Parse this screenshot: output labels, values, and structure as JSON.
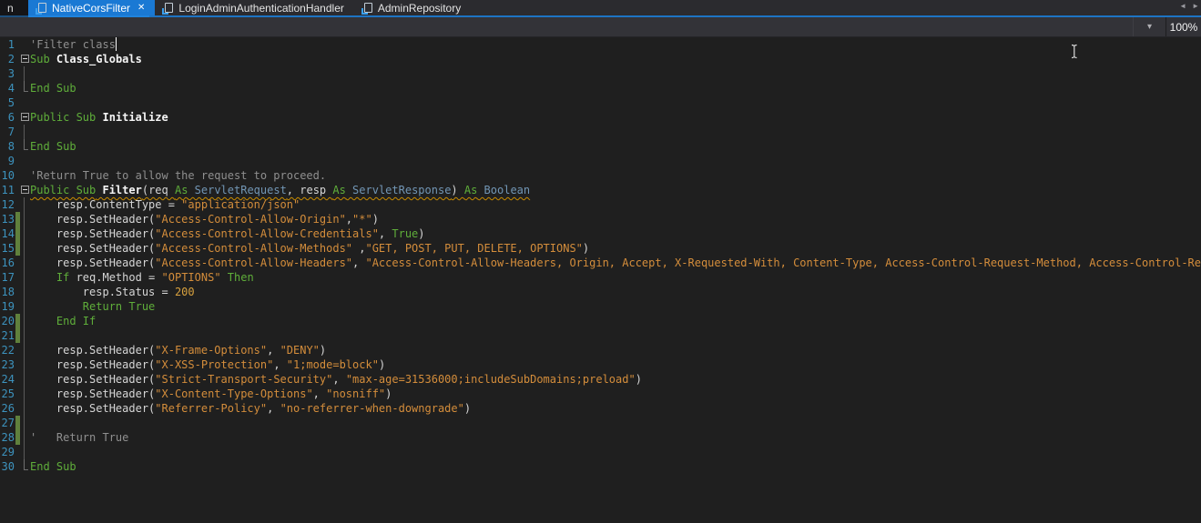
{
  "tabs": {
    "partial_label": "n",
    "items": [
      {
        "label": "NativeCorsFilter",
        "active": true,
        "close_glyph": "✕"
      },
      {
        "label": "LoginAdminAuthenticationHandler",
        "active": false
      },
      {
        "label": "AdminRepository",
        "active": false
      }
    ],
    "scroll_left_glyph": "◄",
    "scroll_right_glyph": "►"
  },
  "toolbar": {
    "dropdown_glyph": "▾",
    "zoom_level": "100%"
  },
  "colors": {
    "active_tab": "#1a79d4",
    "editor_bg": "#1f1f1f",
    "keyword": "#5fae3a",
    "string": "#d48d3b",
    "comment": "#8f8f8f",
    "type": "#7296b5",
    "line_number": "#3d93be",
    "change_marker": "#60803c",
    "warning_squiggle": "#c98c00"
  },
  "editor": {
    "lines": [
      {
        "n": 1,
        "caret": true,
        "tokens": [
          [
            "comment",
            "'Filter class"
          ]
        ]
      },
      {
        "n": 2,
        "fold": "open",
        "tokens": [
          [
            "kw",
            "Sub"
          ],
          [
            "plain",
            " "
          ],
          [
            "ident",
            "Class_Globals"
          ]
        ]
      },
      {
        "n": 3,
        "fold": "guide",
        "tokens": []
      },
      {
        "n": 4,
        "fold": "end",
        "tokens": [
          [
            "kw",
            "End Sub"
          ]
        ]
      },
      {
        "n": 5,
        "tokens": []
      },
      {
        "n": 6,
        "fold": "open",
        "tokens": [
          [
            "kw",
            "Public Sub"
          ],
          [
            "plain",
            " "
          ],
          [
            "ident",
            "Initialize"
          ]
        ]
      },
      {
        "n": 7,
        "fold": "guide",
        "tokens": []
      },
      {
        "n": 8,
        "fold": "end",
        "tokens": [
          [
            "kw",
            "End Sub"
          ]
        ]
      },
      {
        "n": 9,
        "tokens": []
      },
      {
        "n": 10,
        "tokens": [
          [
            "comment",
            "'Return True to allow the request to proceed."
          ]
        ]
      },
      {
        "n": 11,
        "fold": "open",
        "squiggle": true,
        "tokens": [
          [
            "kw",
            "Public Sub"
          ],
          [
            "plain",
            " "
          ],
          [
            "ident",
            "Filter"
          ],
          [
            "plain",
            "(req "
          ],
          [
            "kw",
            "As"
          ],
          [
            "type",
            " ServletRequest"
          ],
          [
            "plain",
            ", resp "
          ],
          [
            "kw",
            "As"
          ],
          [
            "type",
            " ServletResponse"
          ],
          [
            "plain",
            ") "
          ],
          [
            "kw",
            "As"
          ],
          [
            "type",
            " Boolean"
          ]
        ]
      },
      {
        "n": 12,
        "fold": "guide",
        "tokens": [
          [
            "plain",
            "    resp.ContentType = "
          ],
          [
            "str",
            "\"application/json\""
          ]
        ]
      },
      {
        "n": 13,
        "fold": "guide",
        "changed": true,
        "tokens": [
          [
            "plain",
            "    resp.SetHeader("
          ],
          [
            "str",
            "\"Access-Control-Allow-Origin\""
          ],
          [
            "plain",
            ","
          ],
          [
            "str",
            "\"*\""
          ],
          [
            "plain",
            ")"
          ]
        ]
      },
      {
        "n": 14,
        "fold": "guide",
        "changed": true,
        "tokens": [
          [
            "plain",
            "    resp.SetHeader("
          ],
          [
            "str",
            "\"Access-Control-Allow-Credentials\""
          ],
          [
            "plain",
            ", "
          ],
          [
            "kw",
            "True"
          ],
          [
            "plain",
            ")"
          ]
        ]
      },
      {
        "n": 15,
        "fold": "guide",
        "changed": true,
        "tokens": [
          [
            "plain",
            "    resp.SetHeader("
          ],
          [
            "str",
            "\"Access-Control-Allow-Methods\""
          ],
          [
            "plain",
            " ,"
          ],
          [
            "str",
            "\"GET, POST, PUT, DELETE, OPTIONS\""
          ],
          [
            "plain",
            ")"
          ]
        ]
      },
      {
        "n": 16,
        "fold": "guide",
        "tokens": [
          [
            "plain",
            "    resp.SetHeader("
          ],
          [
            "str",
            "\"Access-Control-Allow-Headers\""
          ],
          [
            "plain",
            ", "
          ],
          [
            "str",
            "\"Access-Control-Allow-Headers, Origin, Accept, X-Requested-With, Content-Type, Access-Control-Request-Method, Access-Control-Request"
          ]
        ]
      },
      {
        "n": 17,
        "fold": "guide",
        "tokens": [
          [
            "plain",
            "    "
          ],
          [
            "kw",
            "If"
          ],
          [
            "plain",
            " req.Method = "
          ],
          [
            "str",
            "\"OPTIONS\""
          ],
          [
            "plain",
            " "
          ],
          [
            "kw",
            "Then"
          ]
        ]
      },
      {
        "n": 18,
        "fold": "guide",
        "tokens": [
          [
            "plain",
            "        resp.Status = "
          ],
          [
            "num",
            "200"
          ]
        ]
      },
      {
        "n": 19,
        "fold": "guide",
        "tokens": [
          [
            "plain",
            "        "
          ],
          [
            "kw",
            "Return True"
          ]
        ]
      },
      {
        "n": 20,
        "fold": "guide",
        "changed": true,
        "tokens": [
          [
            "plain",
            "    "
          ],
          [
            "kw",
            "End If"
          ]
        ]
      },
      {
        "n": 21,
        "fold": "guide",
        "changed": true,
        "tokens": []
      },
      {
        "n": 22,
        "fold": "guide",
        "tokens": [
          [
            "plain",
            "    resp.SetHeader("
          ],
          [
            "str",
            "\"X-Frame-Options\""
          ],
          [
            "plain",
            ", "
          ],
          [
            "str",
            "\"DENY\""
          ],
          [
            "plain",
            ")"
          ]
        ]
      },
      {
        "n": 23,
        "fold": "guide",
        "tokens": [
          [
            "plain",
            "    resp.SetHeader("
          ],
          [
            "str",
            "\"X-XSS-Protection\""
          ],
          [
            "plain",
            ", "
          ],
          [
            "str",
            "\"1;mode=block\""
          ],
          [
            "plain",
            ")"
          ]
        ]
      },
      {
        "n": 24,
        "fold": "guide",
        "tokens": [
          [
            "plain",
            "    resp.SetHeader("
          ],
          [
            "str",
            "\"Strict-Transport-Security\""
          ],
          [
            "plain",
            ", "
          ],
          [
            "str",
            "\"max-age=31536000;includeSubDomains;preload\""
          ],
          [
            "plain",
            ")"
          ]
        ]
      },
      {
        "n": 25,
        "fold": "guide",
        "tokens": [
          [
            "plain",
            "    resp.SetHeader("
          ],
          [
            "str",
            "\"X-Content-Type-Options\""
          ],
          [
            "plain",
            ", "
          ],
          [
            "str",
            "\"nosniff\""
          ],
          [
            "plain",
            ")"
          ]
        ]
      },
      {
        "n": 26,
        "fold": "guide",
        "tokens": [
          [
            "plain",
            "    resp.SetHeader("
          ],
          [
            "str",
            "\"Referrer-Policy\""
          ],
          [
            "plain",
            ", "
          ],
          [
            "str",
            "\"no-referrer-when-downgrade\""
          ],
          [
            "plain",
            ")"
          ]
        ]
      },
      {
        "n": 27,
        "fold": "guide",
        "changed": true,
        "tokens": []
      },
      {
        "n": 28,
        "fold": "guide",
        "changed": true,
        "tokens": [
          [
            "comment",
            "'   Return True"
          ]
        ]
      },
      {
        "n": 29,
        "fold": "guide",
        "tokens": []
      },
      {
        "n": 30,
        "fold": "end",
        "tokens": [
          [
            "kw",
            "End Sub"
          ]
        ]
      }
    ]
  }
}
